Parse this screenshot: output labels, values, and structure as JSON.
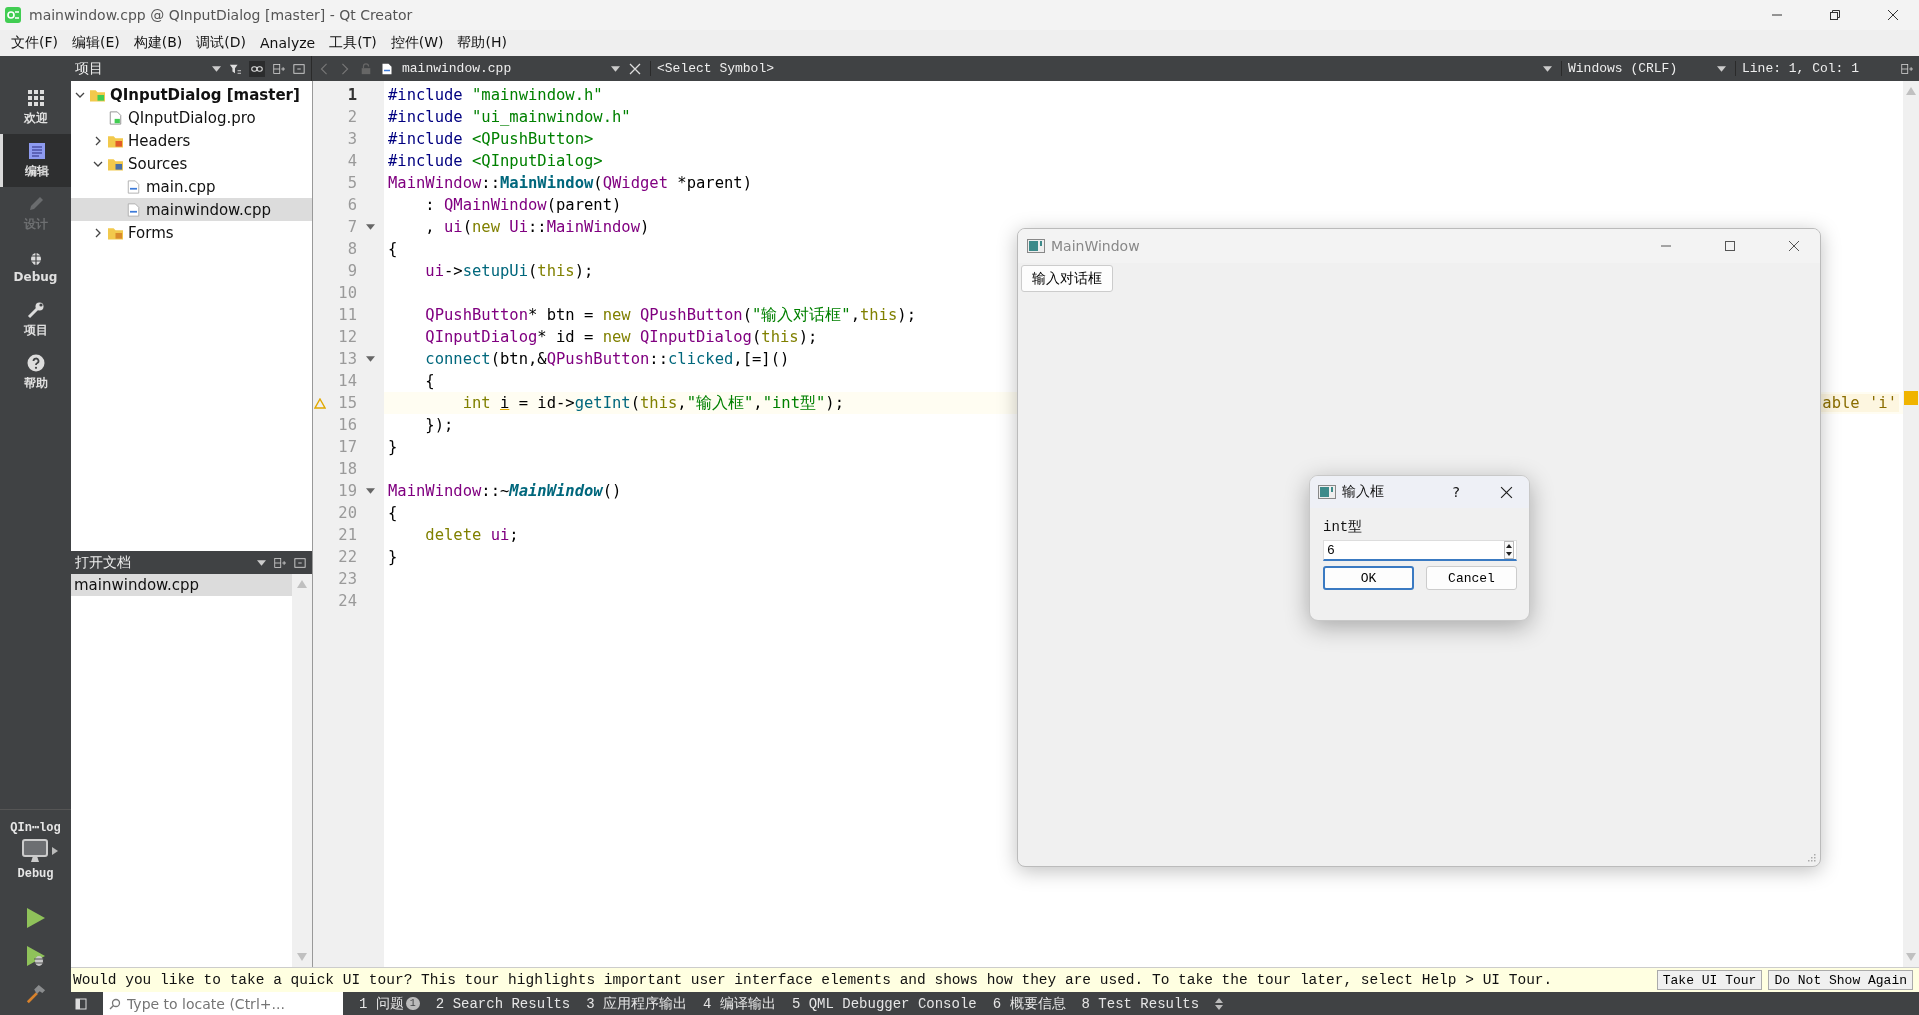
{
  "window": {
    "title": "mainwindow.cpp @ QInputDialog [master] - Qt Creator"
  },
  "menu": [
    "文件(F)",
    "编辑(E)",
    "构建(B)",
    "调试(D)",
    "Analyze",
    "工具(T)",
    "控件(W)",
    "帮助(H)"
  ],
  "modes": [
    {
      "label": "欢迎",
      "selected": false,
      "disabled": false
    },
    {
      "label": "编辑",
      "selected": true,
      "disabled": false
    },
    {
      "label": "设计",
      "selected": false,
      "disabled": true
    },
    {
      "label": "Debug",
      "selected": false,
      "disabled": false
    },
    {
      "label": "项目",
      "selected": false,
      "disabled": false
    },
    {
      "label": "帮助",
      "selected": false,
      "disabled": false
    }
  ],
  "target": {
    "project": "QIn⋯log",
    "config": "Debug"
  },
  "project_panel": {
    "title": "项目",
    "tree": [
      {
        "label": "QInputDialog [master]",
        "kind": "project",
        "expanded": true,
        "selected": false,
        "children": [
          {
            "label": "QInputDialog.pro",
            "kind": "pro",
            "selected": false
          },
          {
            "label": "Headers",
            "kind": "headers",
            "expanded": false,
            "selected": false
          },
          {
            "label": "Sources",
            "kind": "sources",
            "expanded": true,
            "selected": false,
            "children": [
              {
                "label": "main.cpp",
                "kind": "cpp",
                "selected": false
              },
              {
                "label": "mainwindow.cpp",
                "kind": "cpp",
                "selected": true
              }
            ]
          },
          {
            "label": "Forms",
            "kind": "forms",
            "expanded": false,
            "selected": false
          }
        ]
      }
    ]
  },
  "open_documents": {
    "title": "打开文档",
    "items": [
      {
        "label": "mainwindow.cpp",
        "selected": true
      }
    ]
  },
  "editor": {
    "file": "mainwindow.cpp",
    "symbol": "<Select Symbol>",
    "line_ending": "Windows (CRLF)",
    "position": "Line: 1, Col: 1",
    "lines": [
      {
        "n": "1",
        "current": true,
        "fold": false,
        "warning": false,
        "tokens": [
          {
            "t": "#include ",
            "kind": "preprocessor"
          },
          {
            "t": "\"mainwindow.h\"",
            "kind": "string"
          }
        ]
      },
      {
        "n": "2",
        "current": false,
        "fold": false,
        "warning": false,
        "tokens": [
          {
            "t": "#include ",
            "kind": "preprocessor"
          },
          {
            "t": "\"ui_mainwindow.h\"",
            "kind": "string"
          }
        ]
      },
      {
        "n": "3",
        "current": false,
        "fold": false,
        "warning": false,
        "tokens": [
          {
            "t": "#include ",
            "kind": "preprocessor"
          },
          {
            "t": "<QPushButton>",
            "kind": "string"
          }
        ]
      },
      {
        "n": "4",
        "current": false,
        "fold": false,
        "warning": false,
        "tokens": [
          {
            "t": "#include ",
            "kind": "preprocessor"
          },
          {
            "t": "<QInputDialog>",
            "kind": "string"
          }
        ]
      },
      {
        "n": "5",
        "current": false,
        "fold": false,
        "warning": false,
        "tokens": [
          {
            "t": "MainWindow",
            "kind": "type"
          },
          {
            "t": "::",
            "kind": "plain"
          },
          {
            "t": "MainWindow",
            "kind": "declaration"
          },
          {
            "t": "(",
            "kind": "plain"
          },
          {
            "t": "QWidget",
            "kind": "type"
          },
          {
            "t": " *parent)",
            "kind": "plain"
          }
        ]
      },
      {
        "n": "6",
        "current": false,
        "fold": false,
        "warning": false,
        "tokens": [
          {
            "t": "    : ",
            "kind": "plain"
          },
          {
            "t": "QMainWindow",
            "kind": "type"
          },
          {
            "t": "(parent)",
            "kind": "plain"
          }
        ]
      },
      {
        "n": "7",
        "current": false,
        "fold": true,
        "warning": false,
        "tokens": [
          {
            "t": "    , ",
            "kind": "plain"
          },
          {
            "t": "ui",
            "kind": "type"
          },
          {
            "t": "(",
            "kind": "plain"
          },
          {
            "t": "new ",
            "kind": "keyword"
          },
          {
            "t": "Ui",
            "kind": "type"
          },
          {
            "t": "::",
            "kind": "plain"
          },
          {
            "t": "MainWindow",
            "kind": "type"
          },
          {
            "t": ")",
            "kind": "plain"
          }
        ]
      },
      {
        "n": "8",
        "current": false,
        "fold": false,
        "warning": false,
        "tokens": [
          {
            "t": "{",
            "kind": "plain"
          }
        ]
      },
      {
        "n": "9",
        "current": false,
        "fold": false,
        "warning": false,
        "tokens": [
          {
            "t": "    ui",
            "kind": "type"
          },
          {
            "t": "->",
            "kind": "plain"
          },
          {
            "t": "setupUi",
            "kind": "function"
          },
          {
            "t": "(",
            "kind": "plain"
          },
          {
            "t": "this",
            "kind": "keyword"
          },
          {
            "t": ");",
            "kind": "plain"
          }
        ]
      },
      {
        "n": "10",
        "current": false,
        "fold": false,
        "warning": false
      },
      {
        "n": "11",
        "current": false,
        "fold": false,
        "warning": false,
        "tokens": [
          {
            "t": "    QPushButton",
            "kind": "type"
          },
          {
            "t": "* btn = ",
            "kind": "plain"
          },
          {
            "t": "new ",
            "kind": "keyword"
          },
          {
            "t": "QPushButton",
            "kind": "type"
          },
          {
            "t": "(",
            "kind": "plain"
          },
          {
            "t": "\"输入对话框\"",
            "kind": "string"
          },
          {
            "t": ",",
            "kind": "plain"
          },
          {
            "t": "this",
            "kind": "keyword"
          },
          {
            "t": ");",
            "kind": "plain"
          }
        ]
      },
      {
        "n": "12",
        "current": false,
        "fold": false,
        "warning": false,
        "tokens": [
          {
            "t": "    QInputDialog",
            "kind": "type"
          },
          {
            "t": "* id = ",
            "kind": "plain"
          },
          {
            "t": "new ",
            "kind": "keyword"
          },
          {
            "t": "QInputDialog",
            "kind": "type"
          },
          {
            "t": "(",
            "kind": "plain"
          },
          {
            "t": "this",
            "kind": "keyword"
          },
          {
            "t": ");",
            "kind": "plain"
          }
        ]
      },
      {
        "n": "13",
        "current": false,
        "fold": true,
        "warning": false,
        "tokens": [
          {
            "t": "    connect",
            "kind": "function"
          },
          {
            "t": "(btn,&",
            "kind": "plain"
          },
          {
            "t": "QPushButton",
            "kind": "type"
          },
          {
            "t": "::",
            "kind": "plain"
          },
          {
            "t": "clicked",
            "kind": "function"
          },
          {
            "t": ",[=]()",
            "kind": "plain"
          }
        ]
      },
      {
        "n": "14",
        "current": false,
        "fold": false,
        "warning": false,
        "tokens": [
          {
            "t": "    {",
            "kind": "plain"
          }
        ]
      },
      {
        "n": "15",
        "current": false,
        "fold": false,
        "warning": true,
        "annotation": "able 'i'",
        "tokens": [
          {
            "t": "        int ",
            "kind": "keyword"
          },
          {
            "t": "i",
            "kind": "warning"
          },
          {
            "t": " = id->",
            "kind": "plain"
          },
          {
            "t": "getInt",
            "kind": "function"
          },
          {
            "t": "(",
            "kind": "plain"
          },
          {
            "t": "this",
            "kind": "keyword"
          },
          {
            "t": ",",
            "kind": "plain"
          },
          {
            "t": "\"输入框\"",
            "kind": "string"
          },
          {
            "t": ",",
            "kind": "plain"
          },
          {
            "t": "\"int型\"",
            "kind": "string"
          },
          {
            "t": ");",
            "kind": "plain"
          }
        ]
      },
      {
        "n": "16",
        "current": false,
        "fold": false,
        "warning": false,
        "tokens": [
          {
            "t": "    });",
            "kind": "plain"
          }
        ]
      },
      {
        "n": "17",
        "current": false,
        "fold": false,
        "warning": false,
        "tokens": [
          {
            "t": "}",
            "kind": "plain"
          }
        ]
      },
      {
        "n": "18",
        "current": false,
        "fold": false,
        "warning": false
      },
      {
        "n": "19",
        "current": false,
        "fold": true,
        "warning": false,
        "tokens": [
          {
            "t": "MainWindow",
            "kind": "type"
          },
          {
            "t": "::~",
            "kind": "plain"
          },
          {
            "t": "MainWindow",
            "kind": "destructor"
          },
          {
            "t": "()",
            "kind": "plain"
          }
        ]
      },
      {
        "n": "20",
        "current": false,
        "fold": false,
        "warning": false,
        "tokens": [
          {
            "t": "{",
            "kind": "plain"
          }
        ]
      },
      {
        "n": "21",
        "current": false,
        "fold": false,
        "warning": false,
        "tokens": [
          {
            "t": "    delete ",
            "kind": "keyword"
          },
          {
            "t": "ui",
            "kind": "type"
          },
          {
            "t": ";",
            "kind": "plain"
          }
        ]
      },
      {
        "n": "22",
        "current": false,
        "fold": false,
        "warning": false,
        "tokens": [
          {
            "t": "}",
            "kind": "plain"
          }
        ]
      },
      {
        "n": "23",
        "current": false,
        "fold": false,
        "warning": false
      },
      {
        "n": "24",
        "current": false,
        "fold": false,
        "warning": false
      }
    ]
  },
  "tour_bar": {
    "text": "Would you like to take a quick UI tour? This tour highlights important user interface elements and shows how they are used. To take the tour later, select Help > UI Tour.",
    "buttons": [
      "Take UI Tour",
      "Do Not Show Again"
    ]
  },
  "status_bar": {
    "search_placeholder": "Type to locate (Ctrl+...",
    "panes": [
      {
        "label": "1 问题",
        "badge": "1"
      },
      {
        "label": "2 Search Results"
      },
      {
        "label": "3 应用程序输出"
      },
      {
        "label": "4 编译输出"
      },
      {
        "label": "5 QML Debugger Console"
      },
      {
        "label": "6 概要信息"
      },
      {
        "label": "8 Test Results"
      }
    ]
  },
  "app_window": {
    "title": "MainWindow",
    "button": "输入对话框"
  },
  "dialog": {
    "title": "输入框",
    "help": "?",
    "label": "int型",
    "value": "6",
    "buttons": [
      {
        "label": "OK",
        "default": true
      },
      {
        "label": "Cancel",
        "default": false
      }
    ]
  }
}
